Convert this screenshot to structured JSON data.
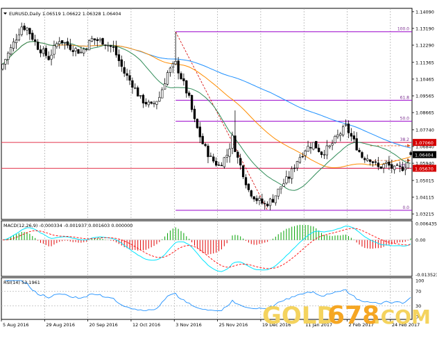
{
  "chart_data": {
    "type": "candlestick",
    "symbol_header": "EURUSD,Daily  1.06519 1.06622 1.06328 1.06404",
    "instrument": "EURUSD",
    "timeframe": "Daily",
    "last_bar": {
      "open": 1.06519,
      "high": 1.06622,
      "low": 1.06328,
      "close": 1.06404
    },
    "price_axis": {
      "ticks": [
        "1.14090",
        "1.13190",
        "1.12290",
        "1.11365",
        "1.10465",
        "1.09565",
        "1.08665",
        "1.07740",
        "1.06840",
        "1.05940",
        "1.05015",
        "1.04115",
        "1.03215"
      ],
      "tick_values": [
        1.1409,
        1.1319,
        1.1229,
        1.11365,
        1.10465,
        1.09565,
        1.08665,
        1.0774,
        1.0684,
        1.0594,
        1.05015,
        1.04115,
        1.03215
      ],
      "range": [
        1.0292,
        1.1427
      ]
    },
    "price_labels": {
      "upper": {
        "text": "1.07060",
        "value": 1.0706,
        "color": "#d40000"
      },
      "current": {
        "text": "1.06404",
        "value": 1.06404,
        "color": "#000000"
      },
      "lower": {
        "text": "1.05670",
        "value": 1.0567,
        "color": "#d40000"
      }
    },
    "horizontal_lines": [
      {
        "name": "resistance",
        "value": 1.0706,
        "color": "#e3344c"
      },
      {
        "name": "support",
        "value": 1.0567,
        "color": "#e3344c"
      }
    ],
    "fibonacci": {
      "color": "#9900cc",
      "levels": [
        {
          "label": "100.0",
          "value": 1.1301
        },
        {
          "label": "61.8",
          "value": 1.0933
        },
        {
          "label": "50.0",
          "value": 1.082
        },
        {
          "label": "38.2",
          "value": 1.0706
        },
        {
          "label": "23.6",
          "value": 1.0567
        },
        {
          "label": "0.0",
          "value": 1.0341
        }
      ]
    },
    "date_axis": {
      "labels": [
        "5 Aug 2016",
        "29 Aug 2016",
        "20 Sep 2016",
        "12 Oct 2016",
        "3 Nov 2016",
        "25 Nov 2016",
        "19 Dec 2016",
        "11 Jan 2017",
        "2 Feb 2017",
        "24 Feb 2017"
      ],
      "label_bar_index": [
        0,
        16,
        32,
        48,
        64,
        80,
        96,
        112,
        128,
        144
      ]
    },
    "bars_count": 152,
    "anchors": [
      [
        0,
        1.11
      ],
      [
        4,
        1.121
      ],
      [
        8,
        1.133
      ],
      [
        10,
        1.132
      ],
      [
        14,
        1.122
      ],
      [
        18,
        1.116
      ],
      [
        22,
        1.126
      ],
      [
        26,
        1.122
      ],
      [
        30,
        1.119
      ],
      [
        34,
        1.126
      ],
      [
        38,
        1.125
      ],
      [
        42,
        1.121
      ],
      [
        46,
        1.108
      ],
      [
        49,
        1.102
      ],
      [
        52,
        1.094
      ],
      [
        56,
        1.09
      ],
      [
        59,
        1.095
      ],
      [
        62,
        1.108
      ],
      [
        65,
        1.113
      ],
      [
        68,
        1.102
      ],
      [
        70,
        1.094
      ],
      [
        72,
        1.082
      ],
      [
        75,
        1.07
      ],
      [
        78,
        1.062
      ],
      [
        81,
        1.058
      ],
      [
        84,
        1.064
      ],
      [
        86,
        1.073
      ],
      [
        88,
        1.062
      ],
      [
        90,
        1.054
      ],
      [
        92,
        1.045
      ],
      [
        95,
        1.04
      ],
      [
        98,
        1.037
      ],
      [
        101,
        1.04
      ],
      [
        104,
        1.047
      ],
      [
        107,
        1.052
      ],
      [
        110,
        1.061
      ],
      [
        113,
        1.067
      ],
      [
        116,
        1.07
      ],
      [
        119,
        1.065
      ],
      [
        122,
        1.068
      ],
      [
        125,
        1.074
      ],
      [
        128,
        1.079
      ],
      [
        131,
        1.071
      ],
      [
        134,
        1.063
      ],
      [
        137,
        1.062
      ],
      [
        140,
        1.057
      ],
      [
        143,
        1.059
      ],
      [
        146,
        1.056
      ],
      [
        149,
        1.057
      ],
      [
        152,
        1.061
      ],
      [
        154,
        1.068
      ],
      [
        156,
        1.0645
      ]
    ],
    "moving_averages": [
      {
        "color": "#1e90ff",
        "period": 100
      },
      {
        "color": "#ff8c00",
        "period": 50
      },
      {
        "color": "#2e8b57",
        "period": 20
      }
    ],
    "ref_arrows": [
      {
        "value": 1.0688,
        "color": "#e0602a"
      },
      {
        "value": 1.0609,
        "color": "#e0602a"
      }
    ],
    "macd": {
      "header": "MACD(12,26,9) -0.000334 -0.001937 0.001603 0.000000",
      "params": [
        12,
        26,
        9
      ],
      "values": [
        -0.000334,
        -0.001937,
        0.001603,
        0.0
      ],
      "axis_ticks": [
        "0.006435",
        "0.00",
        "-0.013523"
      ],
      "axis_values": [
        0.006435,
        0.0,
        -0.013523
      ],
      "main_color": "#00e5ff",
      "signal_color": "#ff0000",
      "hist_pos_color": "#00a000",
      "hist_neg_color": "#e00000"
    },
    "rsi": {
      "header": "RSI(14) 53.1961",
      "period": 14,
      "value": 53.1961,
      "axis_ticks": [
        "100",
        "70",
        "30",
        "0"
      ],
      "axis_values": [
        100,
        70,
        30,
        0
      ],
      "line_color": "#1e90ff",
      "level_color": "#bbbbbb"
    },
    "candle_colors": {
      "up": "#000000",
      "down": "#000000",
      "wick": "#000000"
    },
    "grid": true,
    "grid_color": "#9a9a9a"
  },
  "watermark": {
    "gold": "GOLD",
    "digits": "678",
    "domain": ".COM",
    "gold_color": "#f4d35e",
    "digits_color": "#f5a623",
    "domain_color": "#f4d35e"
  }
}
